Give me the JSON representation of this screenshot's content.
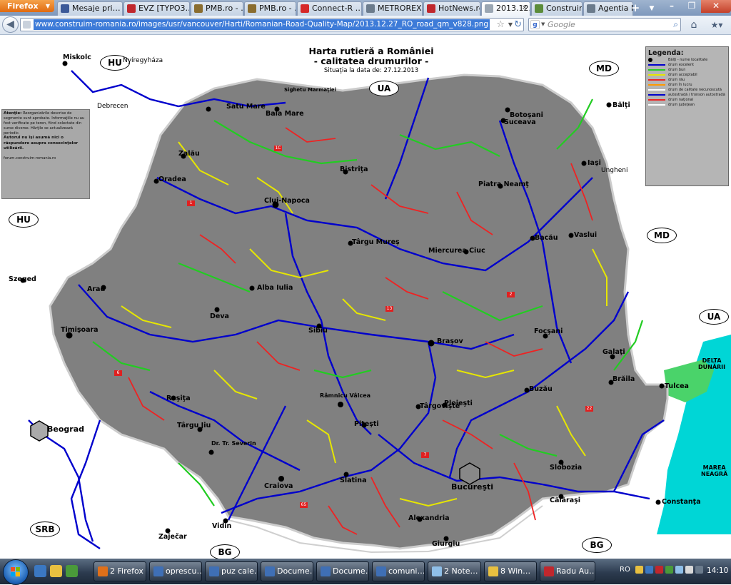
{
  "browser": {
    "menu_label": "Firefox",
    "tabs": [
      {
        "label": "Mesaje pri…",
        "color": "#3b5998"
      },
      {
        "label": "EVZ [TYPO3…",
        "color": "#c0272d"
      },
      {
        "label": "PMB.ro - …",
        "color": "#8a6d2f"
      },
      {
        "label": "PMB.ro - …",
        "color": "#8a6d2f"
      },
      {
        "label": "Connect-R …",
        "color": "#d62828"
      },
      {
        "label": "METROREX",
        "color": "#6b7b8c"
      },
      {
        "label": "HotNews.ro…",
        "color": "#c0272d"
      },
      {
        "label": "2013.12.2…",
        "color": "#9aa6b3"
      },
      {
        "label": "Construim …",
        "color": "#5b8c3a"
      },
      {
        "label": "Agentia D…",
        "color": "#6b7b8c"
      }
    ],
    "new_tab": "+",
    "url": "www.construim-romania.ro/images/usr/vancouver/Harti/Romanian-Road-Quality-Map/2013.12.27_RO_road_qm_v828.png",
    "search_engine": "g",
    "search_placeholder": "Google"
  },
  "map": {
    "title_line1": "Harta rutieră a României",
    "title_line2": "- calitatea drumurilor -",
    "date_text": "Situaţia la data de: 27.12.2013",
    "countries": [
      "HU",
      "UA",
      "MD",
      "HU",
      "MD",
      "UA",
      "SRB",
      "BG",
      "BG"
    ],
    "cities": [
      "Miskolc",
      "Nyíregyháza",
      "Debrecen",
      "Satu Mare",
      "Baia Mare",
      "Sighetu Marmaţiei",
      "Suceava",
      "Botoşani",
      "Bălţi",
      "Oradea",
      "Zalău",
      "Bistriţa",
      "Iaşi",
      "Ungheni",
      "Cluj-Napoca",
      "Târgu Mureş",
      "Piatra Neamţ",
      "Bacău",
      "Vaslui",
      "Arad",
      "Szeged",
      "Alba Iulia",
      "Miercurea Ciuc",
      "Timişoara",
      "Deva",
      "Sibiu",
      "Braşov",
      "Focşani",
      "Galaţi",
      "Brăila",
      "Tulcea",
      "Reşiţa",
      "Târgu Jiu",
      "Râmnicu Vâlcea",
      "Piteşti",
      "Ploieşti",
      "Buzău",
      "Târgovişte",
      "Beograd",
      "Dr. Tr. Severin",
      "Craiova",
      "Slatina",
      "Bucureşti",
      "Slobozia",
      "Călăraşi",
      "Constanţa",
      "Alexandria",
      "Giurgiu",
      "Vidin",
      "Zaječar"
    ],
    "warning_title": "Atenţie:",
    "warning_text": "Reorganizările descrise de segmente sunt aprobate. Informaţiile nu au fost verificate pe teren, fiind colectate din surse diverse. Hărţile se actualizează periodic.",
    "warning_bold": "Autorul nu îşi asumă nici o răspundere asupra consecinţelor utilizării.",
    "warning_forum": "forum.construim-romania.ro",
    "legend_title": "Legenda:",
    "legend_items": [
      {
        "label": "Bălţi - nume localitate",
        "color": "#000000"
      },
      {
        "label": "drum excelent",
        "color": "#0000cc"
      },
      {
        "label": "drum bun",
        "color": "#22cc22"
      },
      {
        "label": "drum acceptabil",
        "color": "#e6e600"
      },
      {
        "label": "drum rău",
        "color": "#ee2222"
      },
      {
        "label": "drum în lucru",
        "color": "#ff9900"
      },
      {
        "label": "drum de calitate necunoscută",
        "color": "#ffffff"
      },
      {
        "label": "autostradă / tronson autostradă",
        "color": "#0000cc"
      },
      {
        "label": "drum naţional",
        "color": "#ee2222"
      },
      {
        "label": "drum judeţean",
        "color": "#ffffff"
      }
    ],
    "delta_label": "DELTA\nDUNĂRII",
    "sea_label": "MAREA\nNEAGRĂ",
    "colors": {
      "land": "#808080",
      "sea": "#00d6d6",
      "excellent": "#0000cc",
      "good": "#22cc22",
      "acceptable": "#e6e600",
      "bad": "#ee2222"
    }
  },
  "taskbar": {
    "buttons": [
      {
        "label": "2 Firefox",
        "color": "#e0701a"
      },
      {
        "label": "oprescu…",
        "color": "#3f6fb5"
      },
      {
        "label": "puz cale…",
        "color": "#3f6fb5"
      },
      {
        "label": "Docume…",
        "color": "#3f6fb5"
      },
      {
        "label": "Docume…",
        "color": "#3f6fb5"
      },
      {
        "label": "comuni…",
        "color": "#3f6fb5"
      },
      {
        "label": "2 Note…",
        "color": "#8fbfe8"
      },
      {
        "label": "8 Win…",
        "color": "#e8c040"
      },
      {
        "label": "Radu Au…",
        "color": "#c0272d"
      }
    ],
    "language": "RO",
    "clock": "14:10"
  }
}
